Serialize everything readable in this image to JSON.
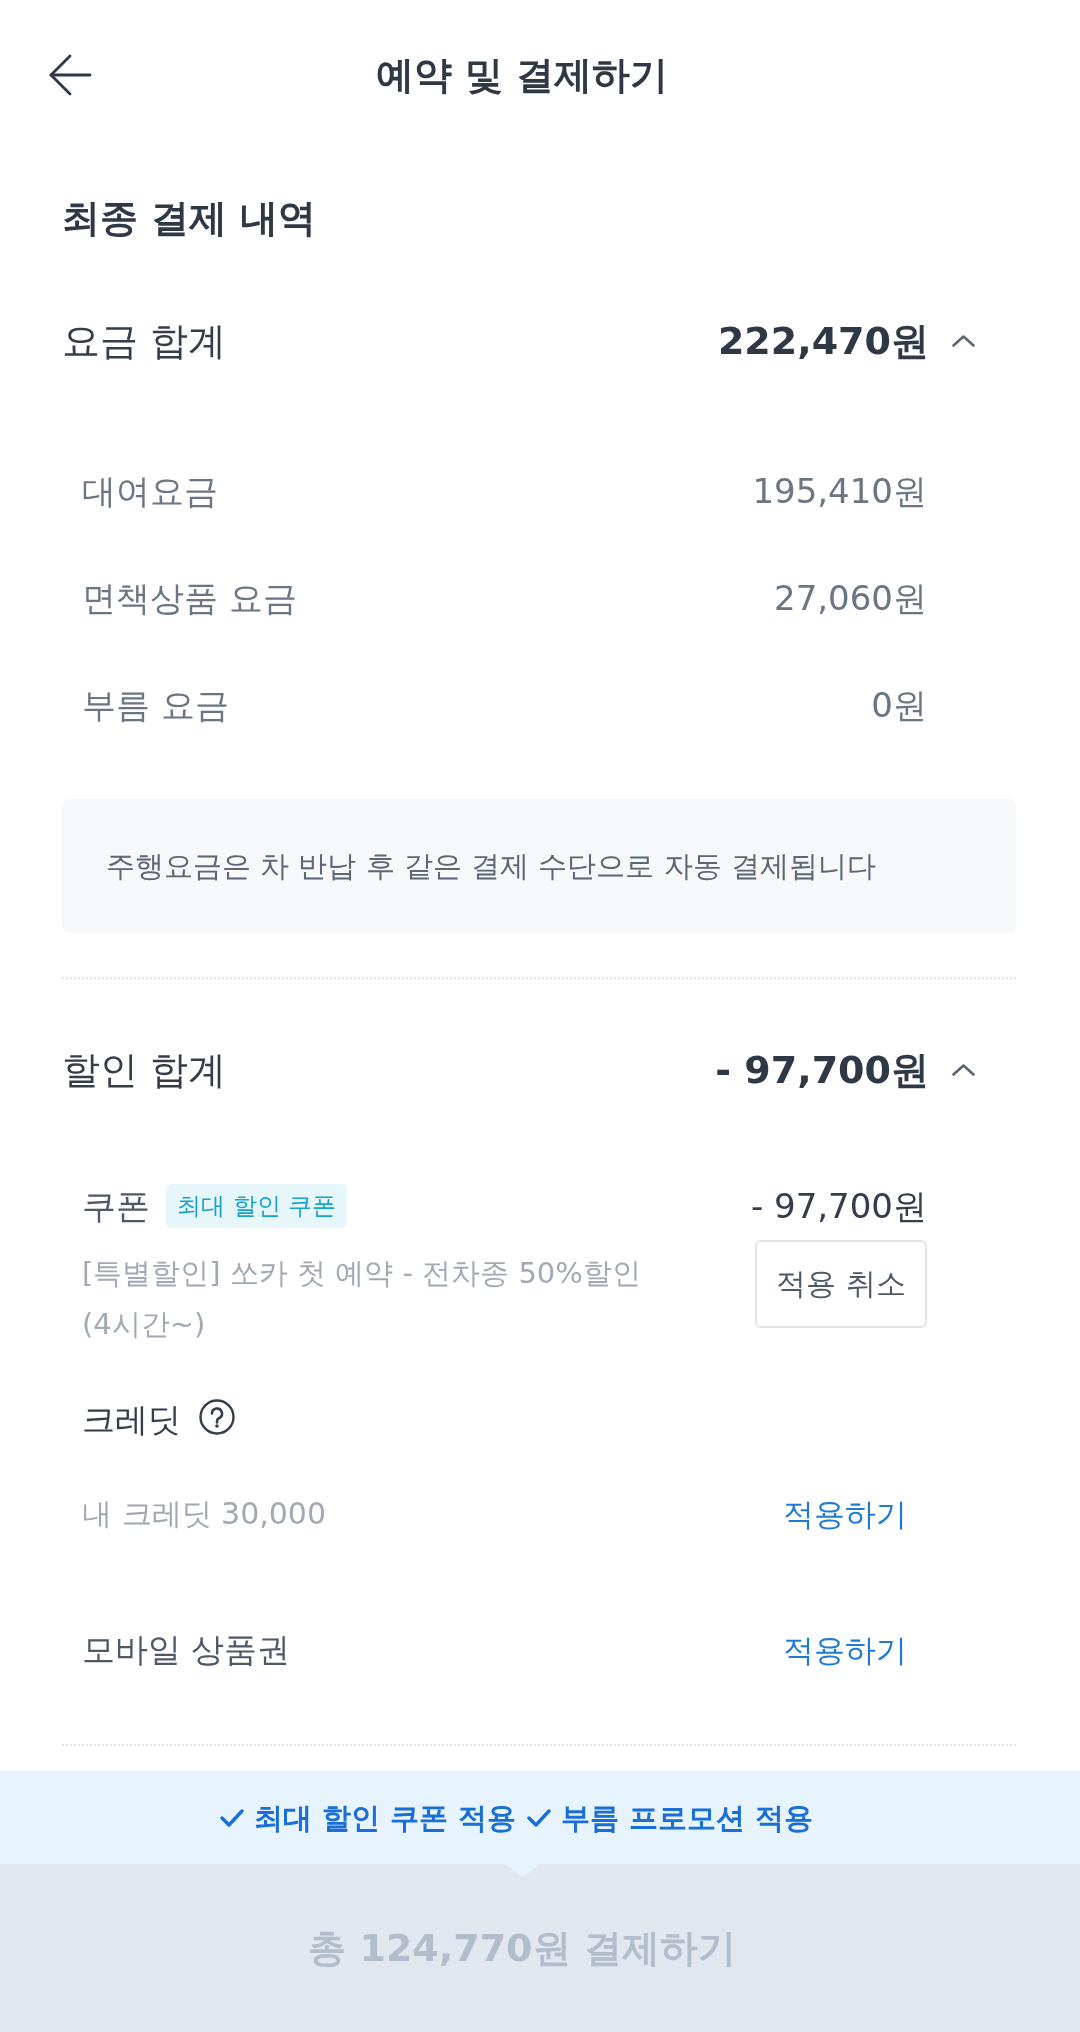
{
  "header": {
    "title": "예약 및 결제하기"
  },
  "section_title": "최종 결제 내역",
  "fee_summary": {
    "label": "요금 합계",
    "amount": "222,470원",
    "expanded": true,
    "items": [
      {
        "label": "대여요금",
        "amount": "195,410원"
      },
      {
        "label": "면책상품 요금",
        "amount": "27,060원"
      },
      {
        "label": "부름 요금",
        "amount": "0원"
      }
    ],
    "notice": "주행요금은 차 반납 후 같은 결제 수단으로 자동 결제됩니다"
  },
  "discount_summary": {
    "label": "할인 합계",
    "amount": "- 97,700원",
    "expanded": true,
    "coupon": {
      "label": "쿠폰",
      "tag": "최대 할인 쿠폰",
      "amount": "- 97,700원",
      "description": "[특별할인] 쏘카 첫 예약 - 전차종 50%할인 (4시간~)",
      "button": "적용 취소"
    },
    "credit": {
      "label": "크레딧",
      "balance": "내 크레딧 30,000",
      "action": "적용하기"
    },
    "gift_card": {
      "label": "모바일 상품권",
      "action": "적용하기"
    }
  },
  "promo_banner": {
    "items": [
      "최대 할인 쿠폰 적용",
      "부름 프로모션 적용"
    ]
  },
  "pay_button": {
    "label": "총 124,770원 결제하기",
    "disabled": true
  }
}
